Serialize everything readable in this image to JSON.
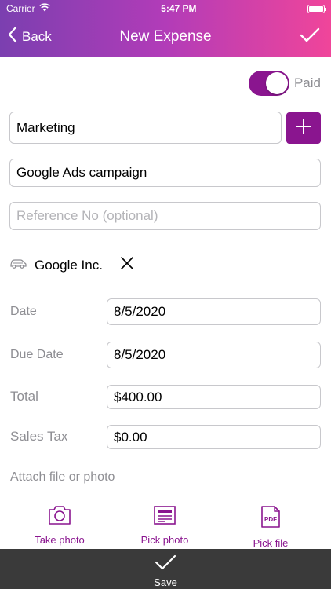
{
  "status": {
    "carrier": "Carrier",
    "time": "5:47 PM"
  },
  "nav": {
    "back_label": "Back",
    "title": "New Expense"
  },
  "paid": {
    "label": "Paid",
    "on": true
  },
  "form": {
    "category": "Marketing",
    "description": "Google Ads campaign",
    "reference_placeholder": "Reference No (optional)",
    "vendor": "Google Inc.",
    "date_label": "Date",
    "date_value": "8/5/2020",
    "due_date_label": "Due Date",
    "due_date_value": "8/5/2020",
    "total_label": "Total",
    "total_value": "$400.00",
    "sales_tax_label": "Sales Tax",
    "sales_tax_value": "$0.00"
  },
  "attachments": {
    "label": "Attach file or photo",
    "take_photo": "Take photo",
    "pick_photo": "Pick photo",
    "pick_file": "Pick file"
  },
  "bottom": {
    "save_label": "Save"
  },
  "colors": {
    "accent": "#8a158f",
    "gradient_start": "#7b3fb0",
    "gradient_end": "#f0459a",
    "bottom_bar": "#3a3a3a"
  },
  "icons": [
    "wifi-icon",
    "battery-icon",
    "chevron-left-icon",
    "checkmark-icon",
    "plus-icon",
    "car-icon",
    "close-icon",
    "camera-icon",
    "photo-icon",
    "pdf-icon",
    "save-check-icon"
  ]
}
